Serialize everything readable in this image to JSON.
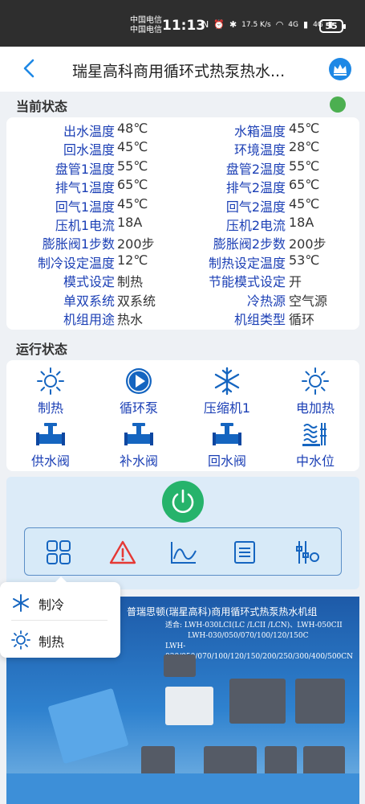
{
  "statusbar": {
    "carrier1": "中国电信",
    "carrier2": "中国电信",
    "time": "11:13",
    "net_speed": "17.5 K/s",
    "signal1": "4G",
    "signal2": "4G",
    "battery": "55"
  },
  "appbar": {
    "title": "瑞星高科商用循环式热泵热水...",
    "back_icon": "chevron-left-icon",
    "crown_icon": "crown-icon",
    "accent": "#1e88e5"
  },
  "current_status": {
    "heading": "当前状态",
    "online_color": "#4caf50",
    "rows": [
      {
        "l1": "出水温度",
        "v1": "48℃",
        "l2": "水箱温度",
        "v2": "45℃"
      },
      {
        "l1": "回水温度",
        "v1": "45℃",
        "l2": "环境温度",
        "v2": "28℃"
      },
      {
        "l1": "盘管1温度",
        "v1": "55℃",
        "l2": "盘管2温度",
        "v2": "55℃"
      },
      {
        "l1": "排气1温度",
        "v1": "65℃",
        "l2": "排气2温度",
        "v2": "65℃"
      },
      {
        "l1": "回气1温度",
        "v1": "45℃",
        "l2": "回气2温度",
        "v2": "45℃"
      },
      {
        "l1": "压机1电流",
        "v1": "18A",
        "l2": "压机2电流",
        "v2": "18A"
      },
      {
        "l1": "膨胀阀1步数",
        "v1": "200步",
        "l2": "膨胀阀2步数",
        "v2": "200步"
      },
      {
        "l1": "制冷设定温度",
        "v1": "12℃",
        "l2": "制热设定温度",
        "v2": "53℃"
      },
      {
        "l1": "模式设定",
        "v1": "制热",
        "l2": "节能模式设定",
        "v2": "开"
      },
      {
        "l1": "单双系统",
        "v1": "双系统",
        "l2": "冷热源",
        "v2": "空气源"
      },
      {
        "l1": "机组用途",
        "v1": "热水",
        "l2": "机组类型",
        "v2": "循环"
      }
    ]
  },
  "run_status": {
    "heading": "运行状态",
    "items": [
      {
        "label": "制热",
        "icon": "sun-icon"
      },
      {
        "label": "循环泵",
        "icon": "play-circle-icon"
      },
      {
        "label": "压缩机1",
        "icon": "snowflake-icon"
      },
      {
        "label": "电加热",
        "icon": "sun-icon"
      },
      {
        "label": "供水阀",
        "icon": "valve-icon"
      },
      {
        "label": "补水阀",
        "icon": "valve-icon"
      },
      {
        "label": "回水阀",
        "icon": "valve-icon"
      },
      {
        "label": "中水位",
        "icon": "water-level-icon"
      }
    ]
  },
  "controls": {
    "power_icon": "power-icon",
    "power_color": "#26b36b",
    "tools": [
      "grid-icon",
      "alarm-icon",
      "chart-icon",
      "list-icon",
      "settings-sliders-icon"
    ]
  },
  "mode_popup": {
    "items": [
      {
        "label": "制冷",
        "icon": "snowflake-icon"
      },
      {
        "label": "制热",
        "icon": "sun-icon"
      }
    ]
  },
  "banner": {
    "title": "普瑞思顿(瑞星高科)商用循环式热泵热水机组",
    "line1": "适合: LWH-030LCI(LC /LCII /LCN)、LWH-050CII",
    "line2": "LWH-030/050/070/100/120/150C",
    "line3": "LWH-030/050/070/100/120/150/200/250/300/400/500CN"
  }
}
